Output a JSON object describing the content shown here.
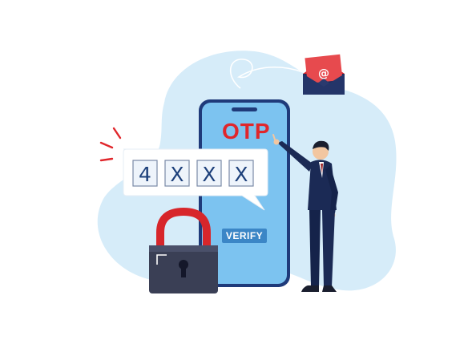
{
  "phone": {
    "title": "OTP",
    "verify_label": "VERIFY"
  },
  "code": {
    "digits": [
      "4",
      "X",
      "X",
      "X"
    ]
  },
  "mail": {
    "symbol": "@",
    "icon": "envelope-icon"
  },
  "lock": {
    "icon": "padlock-icon"
  },
  "colors": {
    "blob": "#d6ecf9",
    "phone_screen": "#7cc3f0",
    "phone_frame": "#1f3a7a",
    "otp_red": "#e0262b",
    "verify_button": "#3b86c6",
    "lock_body": "#3a3f55",
    "lock_shackle": "#d7262b",
    "envelope": "#d7262b",
    "suit": "#1b2a55"
  }
}
